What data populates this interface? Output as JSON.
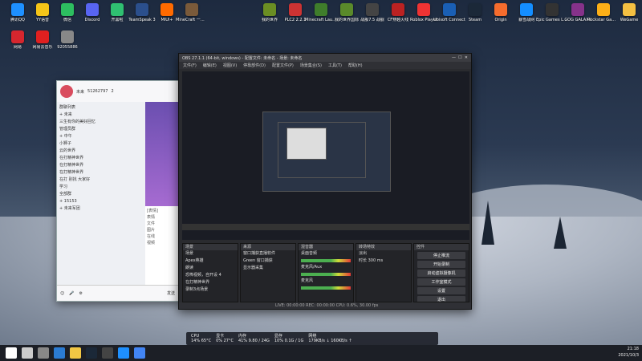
{
  "desktop_icons_left": [
    {
      "label": "腾讯QQ",
      "color": "#1e90ff"
    },
    {
      "label": "YY语音",
      "color": "#f5c518"
    },
    {
      "label": "微信",
      "color": "#2dbe60"
    },
    {
      "label": "Discord",
      "color": "#5865f2"
    },
    {
      "label": "开黑啦",
      "color": "#2fbf71"
    },
    {
      "label": "TeamSpeak 3",
      "color": "#2b4f8c"
    },
    {
      "label": "MIUI+",
      "color": "#ff6a00"
    },
    {
      "label": "MineCraft 一键开服器",
      "color": "#7a5a3a"
    },
    {
      "label": "网易",
      "color": "#d6262e"
    },
    {
      "label": "网易云音乐",
      "color": "#e02020"
    },
    {
      "label": "92055886",
      "color": "#888"
    }
  ],
  "desktop_icons_right": [
    {
      "label": "我的世界",
      "color": "#6b8e23"
    },
    {
      "label": "PLC2 2.2.1",
      "color": "#c33"
    },
    {
      "label": "Minecraft Launcher",
      "color": "#3f7d2b"
    },
    {
      "label": "我的世界国际",
      "color": "#5a8a2a"
    },
    {
      "label": "战舰7.5 战舰",
      "color": "#444"
    },
    {
      "label": "CF穿越火线",
      "color": "#b22"
    },
    {
      "label": "Roblox Player",
      "color": "#e33"
    },
    {
      "label": "Ubisoft Connect",
      "color": "#1a5fb4"
    },
    {
      "label": "Steam",
      "color": "#1b2838"
    },
    {
      "label": "Origin",
      "color": "#f56c2d"
    },
    {
      "label": "暴雪战网",
      "color": "#148eff"
    },
    {
      "label": "Epic Games Launcher",
      "color": "#333"
    },
    {
      "label": "GOG GALAXY",
      "color": "#86328a"
    },
    {
      "label": "Rockstar Games",
      "color": "#fcaf17"
    },
    {
      "label": "WeGame",
      "color": "#f4c042"
    }
  ],
  "qq": {
    "name": "未来",
    "number": "51262797",
    "members": "2",
    "chats": [
      "群聊列表",
      "+ 未来",
      "三生有你的美好回忆",
      "管理员群",
      "+ 中午",
      "小狮子",
      "云的世界",
      "在打精神世界",
      "在打精神世界",
      "在打精神世界",
      "在打 别找 大家好",
      "学习",
      "全部群",
      "+ 15153",
      "+ 未来军团"
    ],
    "side_items": [
      "[表情]",
      "表情",
      "文件",
      "图片",
      "在线",
      "视频"
    ],
    "send_label": "发送"
  },
  "obs": {
    "title": "OBS 27.1.1 (64-bit, windows) - 配置文件: 未命名 - 场景: 未命名",
    "menus": [
      "文件(F)",
      "编辑(E)",
      "视图(V)",
      "停靠部件(D)",
      "配置文件(P)",
      "场景集合(S)",
      "工具(T)",
      "帮助(H)"
    ],
    "panels": {
      "scenes": {
        "title": "场景",
        "items": [
          "场景",
          "Apex英雄",
          "朗读",
          "恐怖视频，自开设 4",
          "在打精神世界",
          "录制3点场景"
        ]
      },
      "sources": {
        "title": "来源",
        "items": [
          "窗口捕获直播软件",
          "Green 窗口捕获",
          "显示器采集"
        ]
      },
      "mixer": {
        "title": "混音器",
        "items": [
          "桌面音频",
          "麦克风/Aux",
          "麦克风"
        ]
      },
      "transitions": {
        "title": "转场特效",
        "items": [
          "淡出",
          "时长 300 ms"
        ]
      },
      "controls": {
        "title": "控件",
        "items": [
          "停止推流",
          "开始录制",
          "启动虚拟摄像机",
          "工作室模式",
          "设置",
          "退出"
        ]
      }
    },
    "status": "LIVE: 00:00:00   REC: 00:00:00   CPU: 0.6%, 30.00 fps"
  },
  "perf": {
    "cpu": {
      "label": "CPU",
      "value": "14%  65°C"
    },
    "gpu": {
      "label": "显卡",
      "value": "0%  27°C"
    },
    "mem": {
      "label": "内存",
      "value": "41%  9.80 / 24G"
    },
    "disk": {
      "label": "显存",
      "value": "10%  0.1G / 1G"
    },
    "net": {
      "label": "网络",
      "value": "179KB/s ↓  160KB/s ↑"
    }
  },
  "clock": {
    "time": "21:18",
    "date": "2021/10/3"
  },
  "taskbar_icons": [
    "start-icon",
    "search-icon",
    "taskview-icon",
    "edge-icon",
    "explorer-icon",
    "steam-icon",
    "obs-icon",
    "qq-icon",
    "chrome-icon"
  ]
}
